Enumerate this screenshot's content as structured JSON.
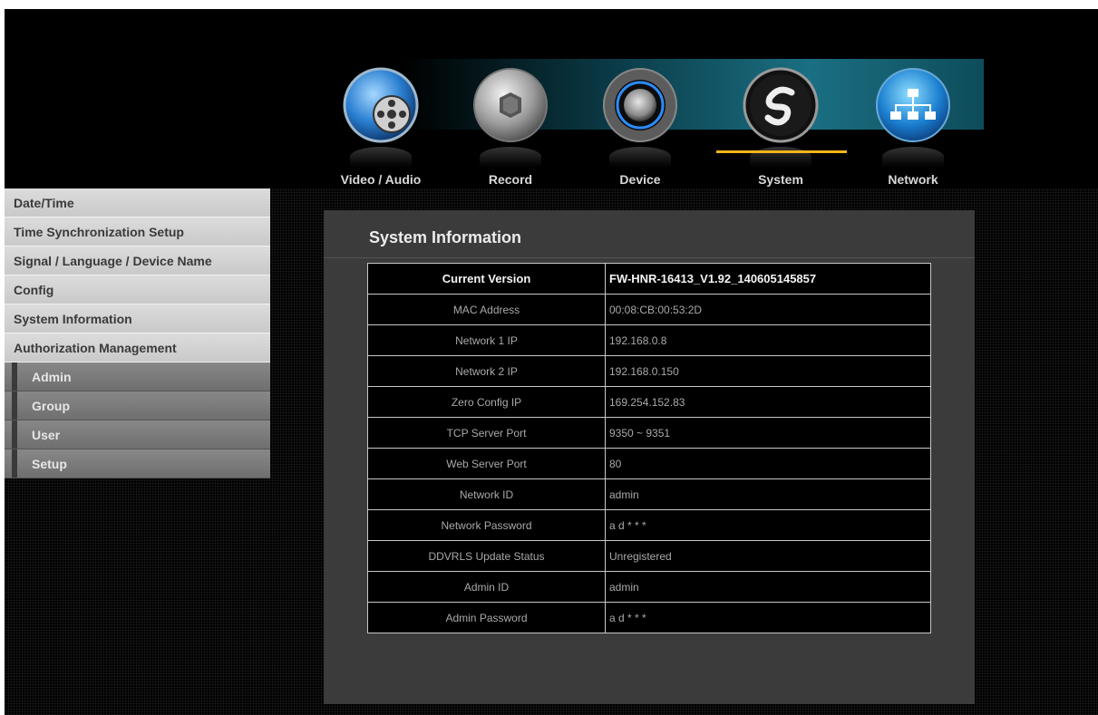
{
  "page_caption": "",
  "nav": [
    {
      "label": "Video / Audio",
      "icon": "film-reel-icon",
      "active": false
    },
    {
      "label": "Record",
      "icon": "record-icon",
      "active": false
    },
    {
      "label": "Device",
      "icon": "device-icon",
      "active": false
    },
    {
      "label": "System",
      "icon": "system-icon",
      "active": true
    },
    {
      "label": "Network",
      "icon": "network-icon",
      "active": false
    }
  ],
  "sidebar": {
    "items": [
      {
        "label": "Date/Time"
      },
      {
        "label": "Time Synchronization Setup"
      },
      {
        "label": "Signal / Language / Device Name"
      },
      {
        "label": "Config"
      },
      {
        "label": "System Information"
      },
      {
        "label": "Authorization Management"
      }
    ],
    "subitems": [
      {
        "label": "Admin"
      },
      {
        "label": "Group"
      },
      {
        "label": "User"
      },
      {
        "label": "Setup"
      }
    ]
  },
  "panel": {
    "title": "System Information",
    "rows": [
      {
        "key": "Current Version",
        "value": "FW-HNR-16413_V1.92_140605145857"
      },
      {
        "key": "MAC Address",
        "value": "00:08:CB:00:53:2D"
      },
      {
        "key": "Network 1  IP",
        "value": "192.168.0.8"
      },
      {
        "key": "Network 2  IP",
        "value": "192.168.0.150"
      },
      {
        "key": "Zero Config IP",
        "value": "169.254.152.83"
      },
      {
        "key": "TCP Server Port",
        "value": "9350 ~ 9351"
      },
      {
        "key": "Web Server Port",
        "value": "80"
      },
      {
        "key": "Network  ID",
        "value": "admin"
      },
      {
        "key": "Network  Password",
        "value": "a d * * *"
      },
      {
        "key": "DDVRLS Update Status",
        "value": "Unregistered"
      },
      {
        "key": "Admin  ID",
        "value": "admin"
      },
      {
        "key": "Admin  Password",
        "value": "a d * * *"
      }
    ]
  },
  "colors": {
    "active_underline": "#f2b418",
    "panel_bg": "#3b3b3b",
    "sidebar_bg": "#d4d4d4",
    "sub_bg": "#7c7c7c"
  }
}
